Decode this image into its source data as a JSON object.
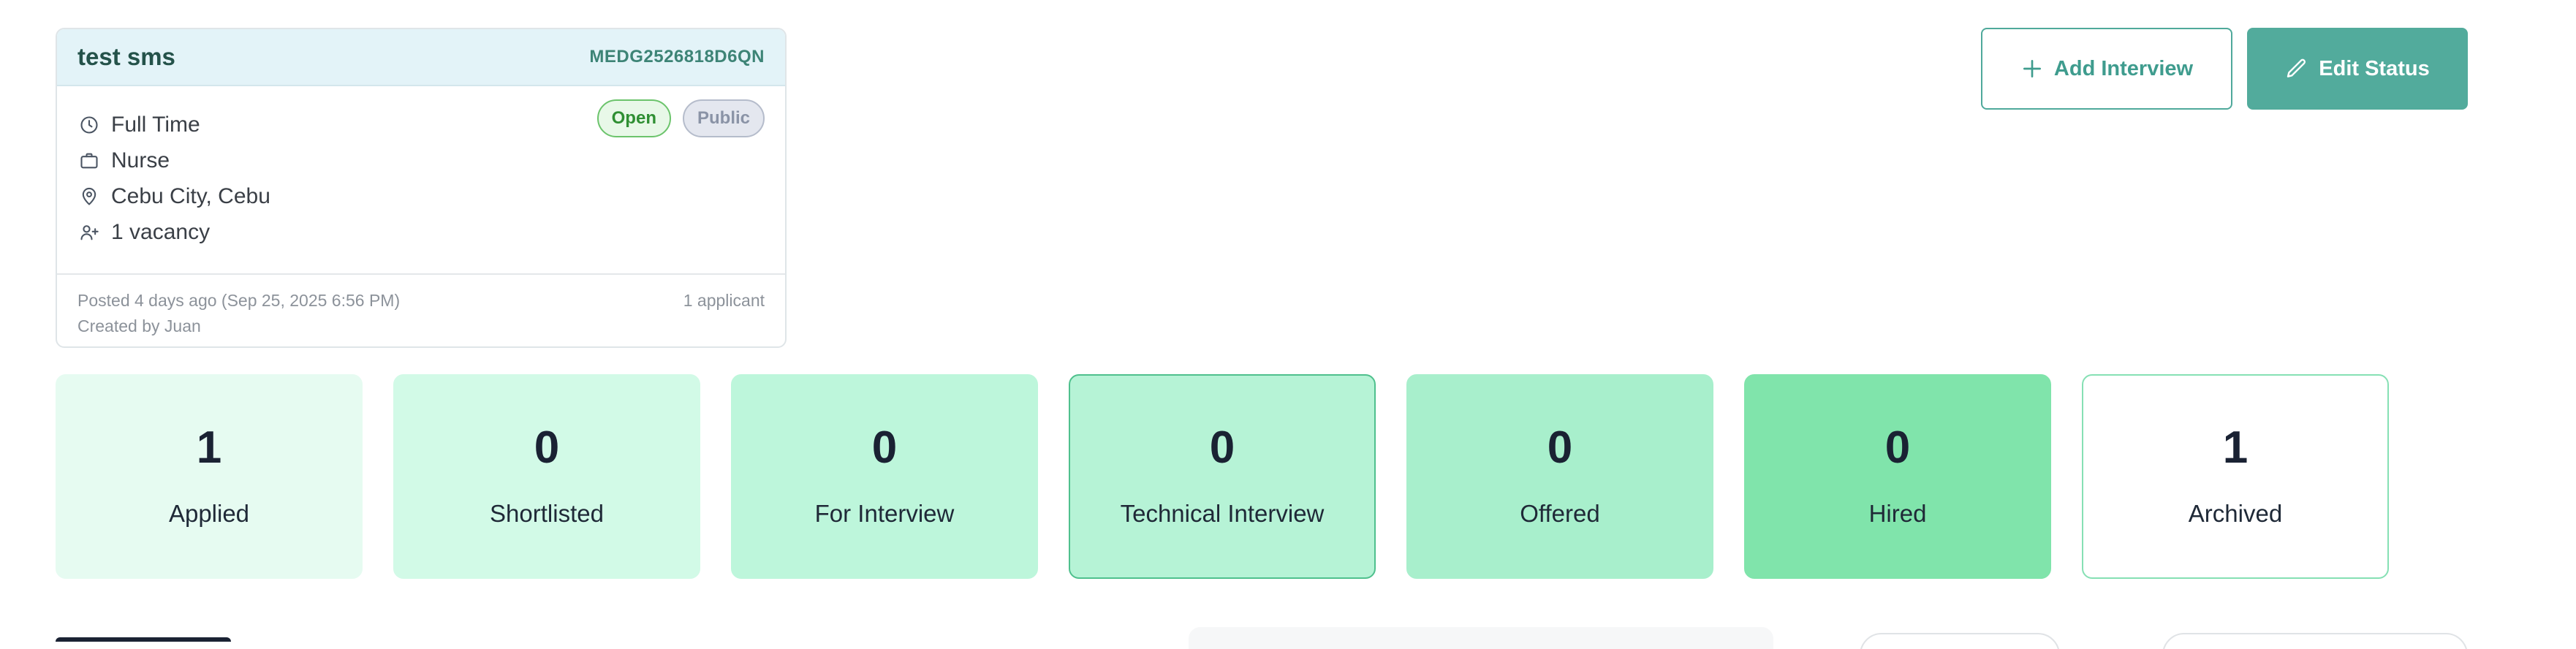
{
  "job": {
    "title": "test sms",
    "code": "MEDG2526818D6QN",
    "status_badge": "Open",
    "visibility_badge": "Public",
    "details": [
      {
        "icon": "clock-icon",
        "text": "Full Time"
      },
      {
        "icon": "briefcase-icon",
        "text": "Nurse"
      },
      {
        "icon": "map-pin-icon",
        "text": "Cebu City, Cebu"
      },
      {
        "icon": "user-plus-icon",
        "text": "1 vacancy"
      }
    ],
    "posted": "Posted 4 days ago (Sep 25, 2025 6:56 PM)",
    "created_by": "Created by Juan",
    "applicant_count": "1 applicant"
  },
  "actions": {
    "add_interview": {
      "label": "Add Interview",
      "icon": "plus-icon"
    },
    "edit_status": {
      "label": "Edit Status",
      "icon": "pencil-icon"
    }
  },
  "pipeline": [
    {
      "label": "Applied",
      "value": "1",
      "bg": "#e6fbf1",
      "border": "#e6fbf1"
    },
    {
      "label": "Shortlisted",
      "value": "0",
      "bg": "#d2fae7",
      "border": "#d2fae7"
    },
    {
      "label": "For Interview",
      "value": "0",
      "bg": "#bdf6db",
      "border": "#bdf6db"
    },
    {
      "label": "Technical Interview",
      "value": "0",
      "bg": "#b6f3d6",
      "border": "#4fc08d"
    },
    {
      "label": "Offered",
      "value": "0",
      "bg": "#a8efcc",
      "border": "#a8efcc"
    },
    {
      "label": "Hired",
      "value": "0",
      "bg": "#80e4ab",
      "border": "#80e4ab"
    },
    {
      "label": "Archived",
      "value": "1",
      "bg": "#ffffff",
      "border": "#86e0b4"
    }
  ],
  "colors": {
    "accent": "#52ab9c",
    "accent_outline": "#4fa99b",
    "open_badge": "#2f8f33",
    "public_badge": "#8a93a6"
  }
}
